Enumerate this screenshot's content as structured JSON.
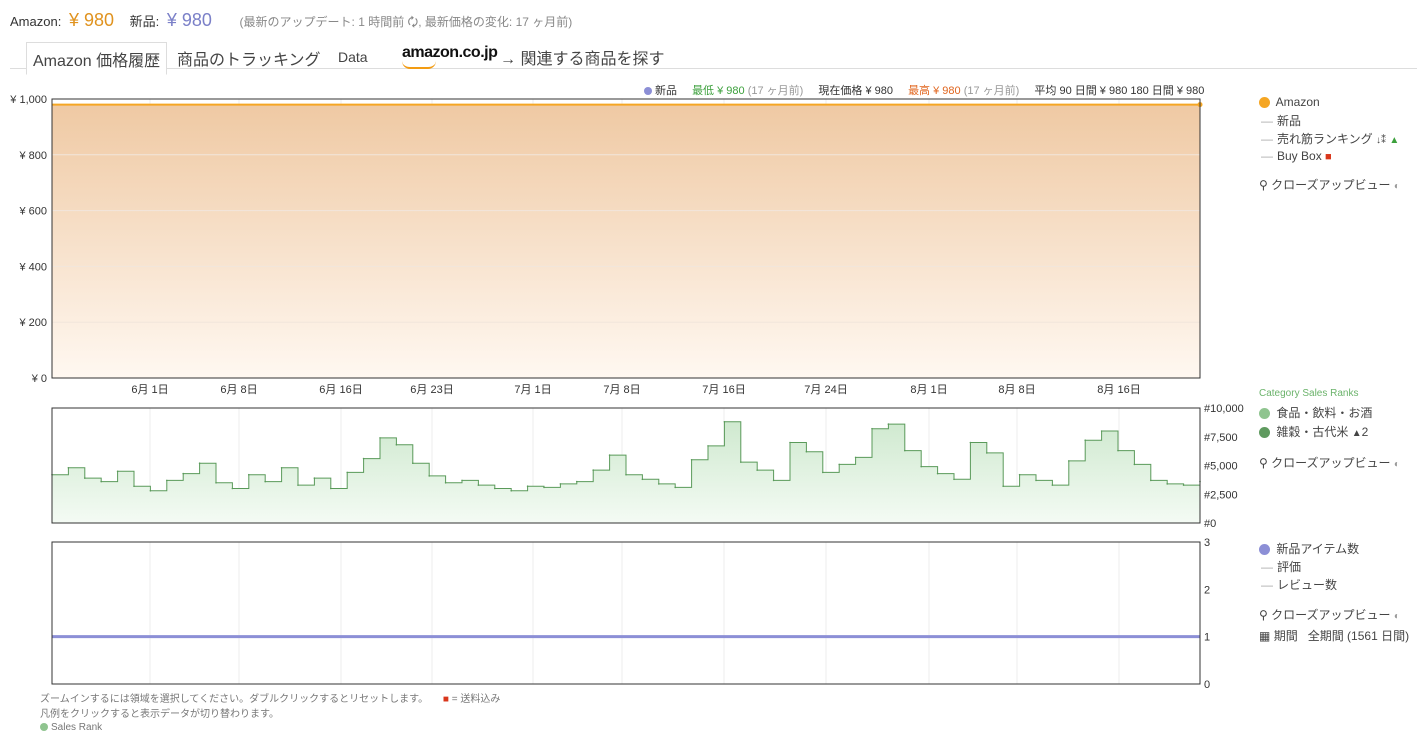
{
  "header": {
    "amazon_label": "Amazon:",
    "amazon_price": "¥ 980",
    "new_label": "新品:",
    "new_price": "¥ 980",
    "meta": "(最新のアップデート: 1 時間前 🗘, 最新価格の変化: 17 ヶ月前)"
  },
  "tabs": {
    "price_history": "Amazon 価格履歴",
    "tracking": "商品のトラッキング",
    "data": "Data",
    "store_logo": "amazon.co.jp",
    "related": "→ 関連する商品を探す"
  },
  "stats": {
    "new_label": "新品",
    "lowest": "最低 ¥ 980",
    "lowest_age": "(17 ヶ月前)",
    "current": "現在価格 ¥ 980",
    "highest": "最高 ¥ 980",
    "highest_age": "(17 ヶ月前)",
    "average": "平均 90 日間 ¥ 980  180 日間 ¥ 980"
  },
  "colors": {
    "amazon": "#f5a623",
    "new": "#8c8fd6",
    "sales_rank": "#5a9a5a",
    "lowest": "#3ca03c",
    "highest": "#e0651e"
  },
  "legend_price": {
    "amazon": "Amazon",
    "new": "新品",
    "sales_rank": "売れ筋ランキング",
    "buybox": "Buy Box",
    "closeup": "クローズアップビュー"
  },
  "legend_rank": {
    "title": "Category Sales Ranks",
    "cat1": "食品・飲料・お酒",
    "cat2": "雑穀・古代米",
    "cat2_suffix": "2",
    "closeup": "クローズアップビュー"
  },
  "legend_count": {
    "new_count": "新品アイテム数",
    "rating": "評価",
    "reviews": "レビュー数",
    "closeup": "クローズアップビュー",
    "period_label": "期間",
    "period_value": "全期間 (1561 日間)"
  },
  "footer": {
    "zoom_hint": "ズームインするには領域を選択してください。ダブルクリックするとリセットします。",
    "shipping": "= 送料込み",
    "legend_hint": "凡例をクリックすると表示データが切り替わります。",
    "sales_rank": "Sales Rank"
  },
  "chart_data": [
    {
      "type": "area",
      "title": "Amazon 価格履歴",
      "x_tick_labels": [
        "6月 1日",
        "6月 8日",
        "6月 16日",
        "6月 23日",
        "7月 1日",
        "7月 8日",
        "7月 16日",
        "7月 24日",
        "8月 1日",
        "8月 8日",
        "8月 16日"
      ],
      "y_tick_labels": [
        "¥ 0",
        "¥ 200",
        "¥ 400",
        "¥ 600",
        "¥ 800",
        "¥ 1,000"
      ],
      "ylim": [
        0,
        1000
      ],
      "series": [
        {
          "name": "Amazon",
          "values": [
            980,
            980
          ]
        }
      ]
    },
    {
      "type": "line",
      "x_tick_labels": [
        "6月 1日",
        "6月 8日",
        "6月 16日",
        "6月 23日",
        "7月 1日",
        "7月 8日",
        "7月 16日",
        "7月 24日",
        "8月 1日",
        "8月 8日",
        "8月 16日"
      ],
      "y_tick_labels": [
        "#0",
        "#2,500",
        "#5,000",
        "#7,500",
        "#10,000"
      ],
      "ylim": [
        0,
        10000
      ],
      "series": [
        {
          "name": "食品・飲料・お酒",
          "values": [
            4200,
            4800,
            3900,
            3600,
            4500,
            3200,
            2800,
            3700,
            4300,
            5200,
            3500,
            3000,
            4200,
            3600,
            4800,
            3300,
            3900,
            3000,
            4400,
            5600,
            7400,
            6800,
            5200,
            4100,
            3500,
            3700,
            3300,
            3000,
            2800,
            3200,
            3100,
            3400,
            3600,
            4600,
            5900,
            4200,
            3800,
            3400,
            3100,
            5500,
            6700,
            8800,
            5300,
            4600,
            3700,
            7000,
            6200,
            4400,
            5100,
            5700,
            8200,
            8600,
            6300,
            4900,
            4300,
            3800,
            7000,
            6100,
            3200,
            4200,
            3700,
            3300,
            5400,
            7200,
            8000,
            6300,
            5100,
            3700,
            3400,
            3300,
            3600
          ]
        }
      ]
    },
    {
      "type": "line",
      "y_tick_labels": [
        "0",
        "1",
        "2",
        "3"
      ],
      "ylim": [
        0,
        3
      ],
      "series": [
        {
          "name": "新品アイテム数",
          "values": [
            1,
            1
          ]
        }
      ]
    }
  ]
}
